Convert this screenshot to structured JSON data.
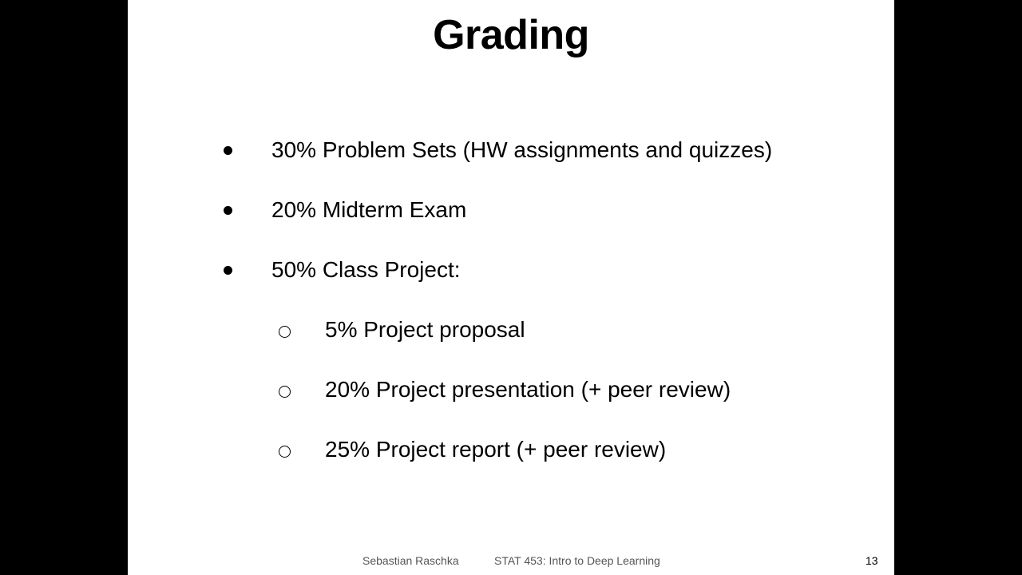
{
  "slide": {
    "title": "Grading",
    "bullets": [
      {
        "text": "30% Problem Sets (HW assignments and quizzes)"
      },
      {
        "text": "20% Midterm Exam"
      },
      {
        "text": "50% Class Project:"
      }
    ],
    "sub_bullets": [
      {
        "text": "5% Project proposal"
      },
      {
        "text": "20% Project presentation (+ peer review)"
      },
      {
        "text": "25% Project report (+ peer review)"
      }
    ],
    "footer": {
      "author": "Sebastian Raschka",
      "course": "STAT 453: Intro to Deep Learning",
      "page_number": "13"
    }
  }
}
